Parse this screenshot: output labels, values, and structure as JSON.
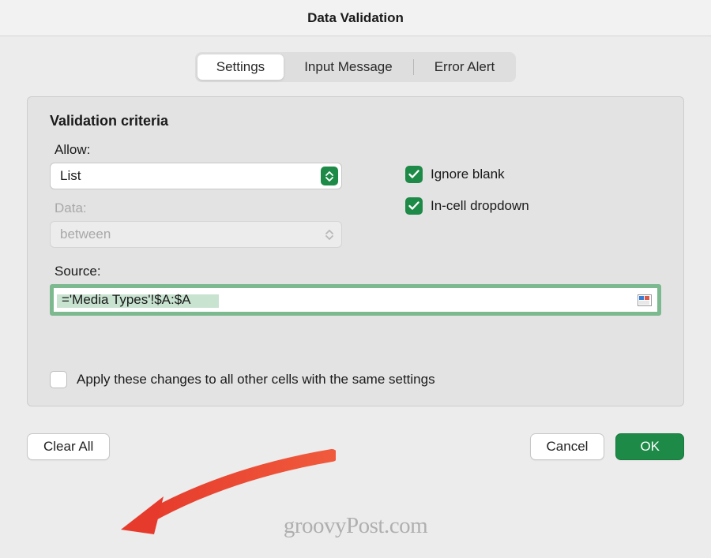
{
  "title": "Data Validation",
  "tabs": {
    "settings": "Settings",
    "input_message": "Input Message",
    "error_alert": "Error Alert"
  },
  "criteria": {
    "heading": "Validation criteria",
    "allow_label": "Allow:",
    "allow_value": "List",
    "data_label": "Data:",
    "data_value": "between",
    "source_label": "Source:",
    "source_value": "='Media Types'!$A:$A"
  },
  "checkboxes": {
    "ignore_blank": "Ignore blank",
    "incell_dropdown": "In-cell dropdown",
    "apply_all": "Apply these changes to all other cells with the same settings"
  },
  "buttons": {
    "clear_all": "Clear All",
    "cancel": "Cancel",
    "ok": "OK"
  },
  "watermark": "groovyPost.com"
}
